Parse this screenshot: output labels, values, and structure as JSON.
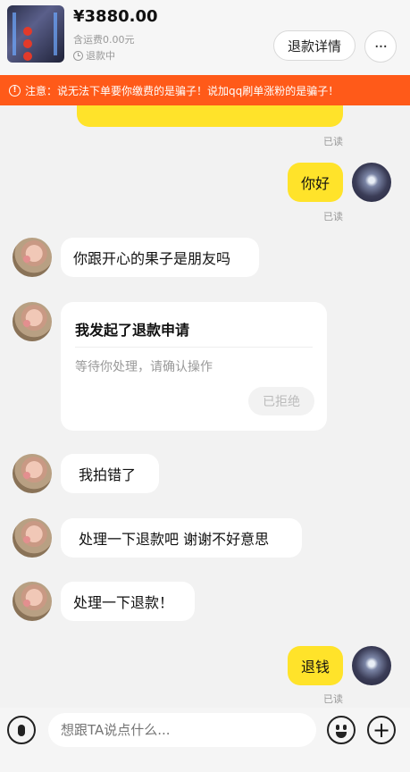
{
  "header": {
    "price": "¥3880.00",
    "shipping": "含运费0.00元",
    "status": "退款中",
    "refund_details_label": "退款详情",
    "more_label": "···"
  },
  "warning": {
    "icon": "!",
    "text": "注意：说无法下单要你缴费的是骗子！说加qq刷单涨粉的是骗子！"
  },
  "messages": [
    {
      "from": "self",
      "text": "",
      "read": "已读"
    },
    {
      "from": "self",
      "text": "你好",
      "read": "已读"
    },
    {
      "from": "other",
      "text": "你跟开心的果子是朋友吗"
    },
    {
      "from": "other",
      "card": {
        "title": "我发起了退款申请",
        "subtitle": "等待你处理，请确认操作",
        "badge": "已拒绝"
      }
    },
    {
      "from": "other",
      "text": "我拍错了"
    },
    {
      "from": "other",
      "text": "处理一下退款吧 谢谢不好意思"
    },
    {
      "from": "other",
      "text": "处理一下退款！"
    },
    {
      "from": "self",
      "text": "退钱",
      "read": "已读"
    }
  ],
  "input": {
    "placeholder": "想跟TA说点什么..."
  },
  "colors": {
    "accent_yellow": "#ffe32a",
    "warning_orange": "#ff5a19",
    "background": "#f2f2f2"
  },
  "icons": {
    "mic": "microphone-icon",
    "emoji": "emoji-icon",
    "plus": "plus-icon",
    "clock": "clock-icon"
  }
}
